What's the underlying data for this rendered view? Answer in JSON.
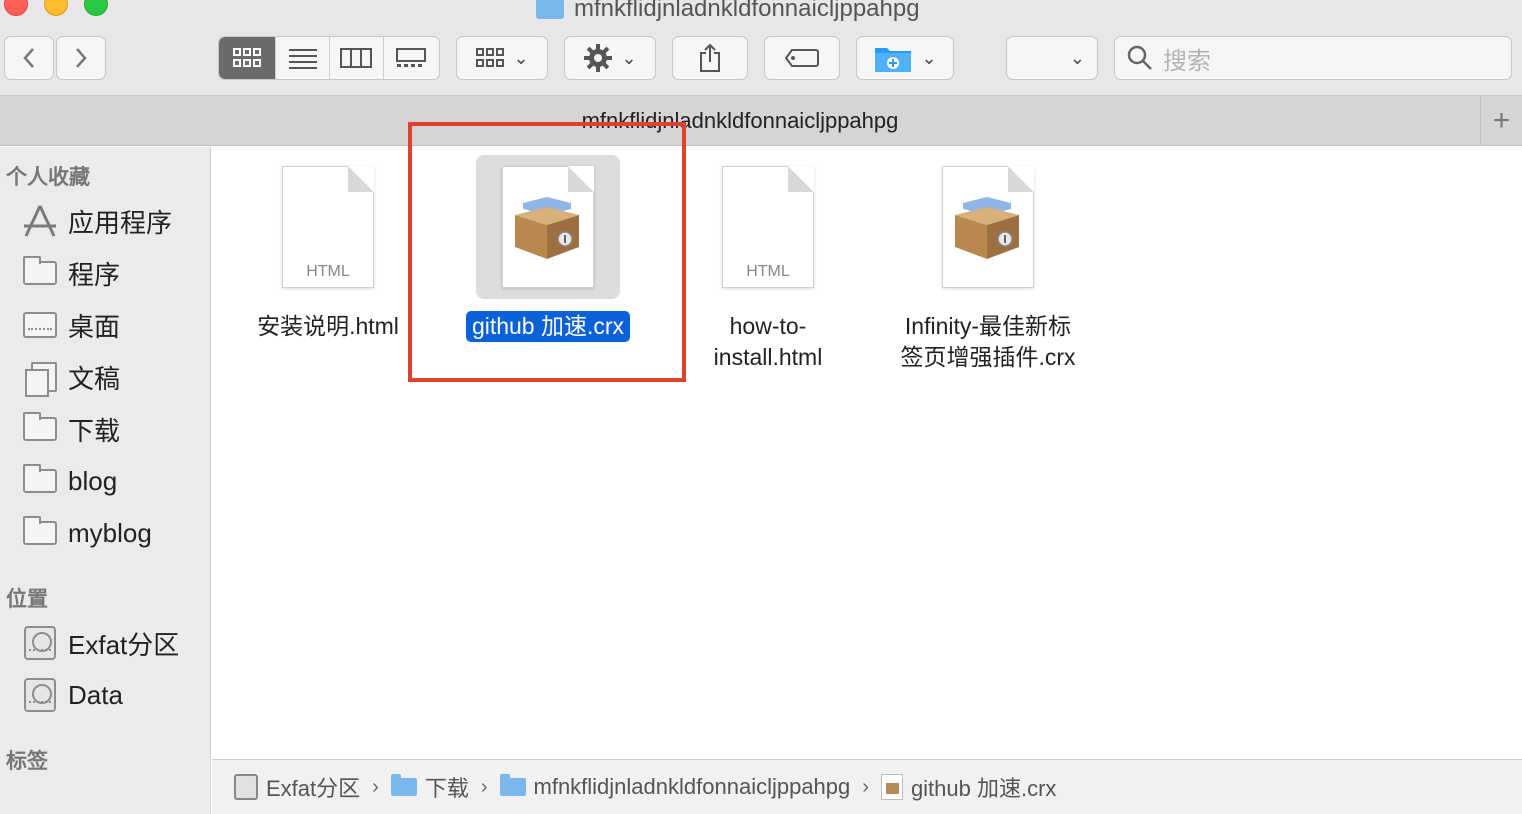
{
  "window": {
    "title": "mfnkflidjnladnkldfonnaicljppahpg"
  },
  "toolbar": {
    "search_placeholder": "搜索"
  },
  "tabbar": {
    "title": "mfnkflidjnladnkldfonnaicljppahpg"
  },
  "sidebar": {
    "favorites_header": "个人收藏",
    "favorites": [
      {
        "label": "应用程序",
        "icon": "applications-icon"
      },
      {
        "label": "程序",
        "icon": "folder-icon"
      },
      {
        "label": "桌面",
        "icon": "desktop-icon"
      },
      {
        "label": "文稿",
        "icon": "documents-icon"
      },
      {
        "label": "下载",
        "icon": "folder-icon"
      },
      {
        "label": "blog",
        "icon": "folder-icon"
      },
      {
        "label": "myblog",
        "icon": "folder-icon"
      }
    ],
    "locations_header": "位置",
    "locations": [
      {
        "label": "Exfat分区",
        "icon": "disk-icon"
      },
      {
        "label": "Data",
        "icon": "disk-icon"
      }
    ],
    "tags_header": "标签"
  },
  "files": [
    {
      "name": "安装说明.html",
      "kind": "HTML",
      "icon": "html-file-icon",
      "selected": false
    },
    {
      "name": "github 加速.crx",
      "kind": "",
      "icon": "crx-package-icon",
      "selected": true
    },
    {
      "name": "how-to-install.html",
      "name_lines": [
        "how-to-",
        "install.html"
      ],
      "kind": "HTML",
      "icon": "html-file-icon",
      "selected": false
    },
    {
      "name": "Infinity-最佳新标签页增强插件.crx",
      "name_lines": [
        "Infinity-最佳新标",
        "签页增强插件.crx"
      ],
      "kind": "",
      "icon": "crx-package-icon",
      "selected": false
    }
  ],
  "pathbar": {
    "items": [
      "Exfat分区",
      "下载",
      "mfnkflidjnladnkldfonnaicljppahpg",
      "github 加速.crx"
    ],
    "separator": "›"
  },
  "colors": {
    "selection": "#0a61d8",
    "highlight_box": "#e0412e",
    "folder_blue": "#79b8ec"
  }
}
